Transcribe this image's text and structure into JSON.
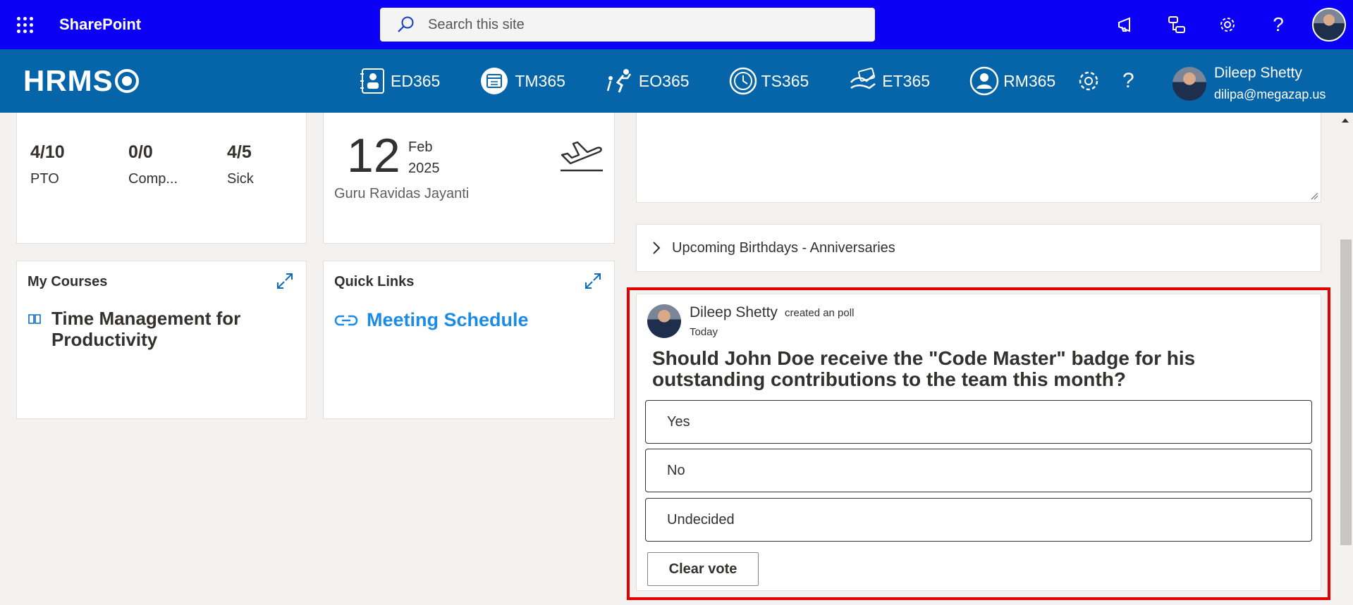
{
  "suitebar": {
    "app_title": "SharePoint",
    "search_placeholder": "Search this site",
    "icons": [
      "megaphone-icon",
      "share-icon",
      "settings-icon",
      "help-icon",
      "avatar"
    ]
  },
  "hrms": {
    "logo": "HRMS",
    "nav": [
      {
        "label": "ED365",
        "icon": "employee-directory-icon"
      },
      {
        "label": "TM365",
        "icon": "calendar-icon"
      },
      {
        "label": "EO365",
        "icon": "onboarding-icon"
      },
      {
        "label": "TS365",
        "icon": "clock-icon"
      },
      {
        "label": "ET365",
        "icon": "expense-icon"
      },
      {
        "label": "RM365",
        "icon": "person-icon"
      }
    ],
    "help_symbol": "?",
    "user": {
      "name": "Dileep Shetty",
      "email": "dilipa@megazap.us"
    }
  },
  "leave": {
    "stats": [
      {
        "value": "4/10",
        "label": "PTO"
      },
      {
        "value": "0/0",
        "label": "Comp..."
      },
      {
        "value": "4/5",
        "label": "Sick"
      }
    ]
  },
  "holiday": {
    "day": "12",
    "month": "Feb",
    "year": "2025",
    "name": "Guru Ravidas Jayanti"
  },
  "courses": {
    "title": "My Courses",
    "item": "Time Management for Productivity"
  },
  "quick_links": {
    "title": "Quick Links",
    "item": "Meeting Schedule"
  },
  "birthdays": {
    "label": "Upcoming Birthdays - Anniversaries"
  },
  "poll": {
    "author": "Dileep Shetty",
    "action": "created an poll",
    "time": "Today",
    "question": "Should John Doe receive the \"Code Master\" badge for his outstanding contributions to the team this month?",
    "options": [
      "Yes",
      "No",
      "Undecided"
    ],
    "clear_label": "Clear vote"
  },
  "colors": {
    "suitebar": "#0b00f5",
    "hrmsbar": "#0664a9",
    "link": "#1b8be8",
    "highlight": "#e30000"
  }
}
